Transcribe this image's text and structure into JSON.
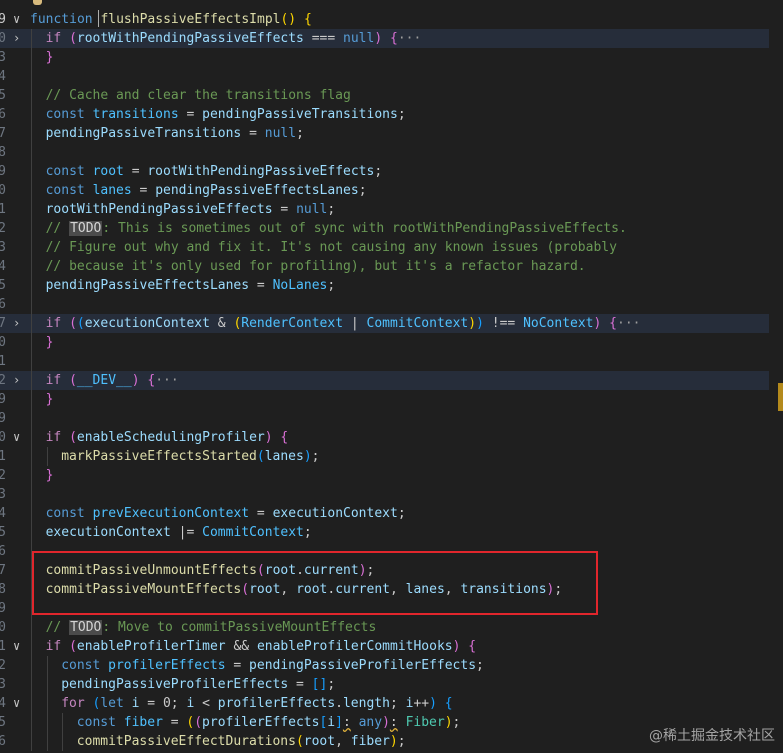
{
  "editor": {
    "lines": [
      {
        "n": "9",
        "fold": "∨",
        "fold_name": "chevron-down-icon",
        "cur": true,
        "hl": false,
        "indent": 0,
        "t": [
          [
            "kw",
            "function"
          ],
          [
            "p",
            " "
          ],
          [
            "fn",
            "flushPassiveEffectsImpl"
          ],
          [
            "b1",
            "("
          ],
          [
            "b1",
            ")"
          ],
          [
            "p",
            " "
          ],
          [
            "b1",
            "{"
          ]
        ]
      },
      {
        "n": "0",
        "fold": "›",
        "fold_name": "chevron-right-icon",
        "hl": true,
        "indent": 1,
        "t": [
          [
            "pc",
            "if"
          ],
          [
            "p",
            " "
          ],
          [
            "b2",
            "("
          ],
          [
            "vr",
            "rootWithPendingPassiveEffects"
          ],
          [
            "p",
            " === "
          ],
          [
            "kw",
            "null"
          ],
          [
            "b2",
            ")"
          ],
          [
            "p",
            " "
          ],
          [
            "b2",
            "{"
          ],
          [
            "ell",
            "···"
          ]
        ]
      },
      {
        "n": "3",
        "indent": 1,
        "t": [
          [
            "b2",
            "}"
          ]
        ]
      },
      {
        "n": "4",
        "indent": 1,
        "t": []
      },
      {
        "n": "5",
        "indent": 1,
        "t": [
          [
            "cm",
            "// Cache and clear the transitions flag"
          ]
        ]
      },
      {
        "n": "6",
        "indent": 1,
        "t": [
          [
            "kw",
            "const"
          ],
          [
            "p",
            " "
          ],
          [
            "cn",
            "transitions"
          ],
          [
            "p",
            " = "
          ],
          [
            "vr",
            "pendingPassiveTransitions"
          ],
          [
            "p",
            ";"
          ]
        ]
      },
      {
        "n": "7",
        "indent": 1,
        "t": [
          [
            "vr",
            "pendingPassiveTransitions"
          ],
          [
            "p",
            " = "
          ],
          [
            "kw",
            "null"
          ],
          [
            "p",
            ";"
          ]
        ]
      },
      {
        "n": "8",
        "indent": 1,
        "t": []
      },
      {
        "n": "9",
        "indent": 1,
        "t": [
          [
            "kw",
            "const"
          ],
          [
            "p",
            " "
          ],
          [
            "cn",
            "root"
          ],
          [
            "p",
            " = "
          ],
          [
            "vr",
            "rootWithPendingPassiveEffects"
          ],
          [
            "p",
            ";"
          ]
        ]
      },
      {
        "n": "0",
        "indent": 1,
        "t": [
          [
            "kw",
            "const"
          ],
          [
            "p",
            " "
          ],
          [
            "cn",
            "lanes"
          ],
          [
            "p",
            " = "
          ],
          [
            "vr",
            "pendingPassiveEffectsLanes"
          ],
          [
            "p",
            ";"
          ]
        ]
      },
      {
        "n": "1",
        "indent": 1,
        "t": [
          [
            "vr",
            "rootWithPendingPassiveEffects"
          ],
          [
            "p",
            " = "
          ],
          [
            "kw",
            "null"
          ],
          [
            "p",
            ";"
          ]
        ]
      },
      {
        "n": "2",
        "indent": 1,
        "t": [
          [
            "cm",
            "// "
          ],
          [
            "todo",
            "TODO"
          ],
          [
            "cm",
            ": This is sometimes out of sync with rootWithPendingPassiveEffects."
          ]
        ]
      },
      {
        "n": "3",
        "indent": 1,
        "t": [
          [
            "cm",
            "// Figure out why and fix it. It's not causing any known issues (probably"
          ]
        ]
      },
      {
        "n": "4",
        "indent": 1,
        "t": [
          [
            "cm",
            "// because it's only used for profiling), but it's a refactor hazard."
          ]
        ]
      },
      {
        "n": "5",
        "indent": 1,
        "t": [
          [
            "vr",
            "pendingPassiveEffectsLanes"
          ],
          [
            "p",
            " = "
          ],
          [
            "cn",
            "NoLanes"
          ],
          [
            "p",
            ";"
          ]
        ]
      },
      {
        "n": "6",
        "indent": 1,
        "t": []
      },
      {
        "n": "7",
        "fold": "›",
        "fold_name": "chevron-right-icon",
        "hl": true,
        "indent": 1,
        "t": [
          [
            "pc",
            "if"
          ],
          [
            "p",
            " "
          ],
          [
            "b2",
            "("
          ],
          [
            "b3",
            "("
          ],
          [
            "vr",
            "executionContext"
          ],
          [
            "p",
            " & "
          ],
          [
            "b1",
            "("
          ],
          [
            "cn",
            "RenderContext"
          ],
          [
            "p",
            " | "
          ],
          [
            "cn",
            "CommitContext"
          ],
          [
            "b1",
            ")"
          ],
          [
            "b3",
            ")"
          ],
          [
            "p",
            " !== "
          ],
          [
            "cn",
            "NoContext"
          ],
          [
            "b2",
            ")"
          ],
          [
            "p",
            " "
          ],
          [
            "b2",
            "{"
          ],
          [
            "ell",
            "···"
          ]
        ]
      },
      {
        "n": "0",
        "indent": 1,
        "t": [
          [
            "b2",
            "}"
          ]
        ]
      },
      {
        "n": "1",
        "indent": 1,
        "t": []
      },
      {
        "n": "2",
        "fold": "›",
        "fold_name": "chevron-right-icon",
        "hl": true,
        "indent": 1,
        "t": [
          [
            "pc",
            "if"
          ],
          [
            "p",
            " "
          ],
          [
            "b2",
            "("
          ],
          [
            "cn",
            "__DEV__"
          ],
          [
            "b2",
            ")"
          ],
          [
            "p",
            " "
          ],
          [
            "b2",
            "{"
          ],
          [
            "ell",
            "···"
          ]
        ]
      },
      {
        "n": "9",
        "indent": 1,
        "t": [
          [
            "b2",
            "}"
          ]
        ]
      },
      {
        "n": "9",
        "indent": 1,
        "t": []
      },
      {
        "n": "0",
        "fold": "∨",
        "fold_name": "chevron-down-icon",
        "indent": 1,
        "t": [
          [
            "pc",
            "if"
          ],
          [
            "p",
            " "
          ],
          [
            "b2",
            "("
          ],
          [
            "vr",
            "enableSchedulingProfiler"
          ],
          [
            "b2",
            ")"
          ],
          [
            "p",
            " "
          ],
          [
            "b2",
            "{"
          ]
        ]
      },
      {
        "n": "1",
        "indent": 2,
        "t": [
          [
            "fn",
            "markPassiveEffectsStarted"
          ],
          [
            "b3",
            "("
          ],
          [
            "vr",
            "lanes"
          ],
          [
            "b3",
            ")"
          ],
          [
            "p",
            ";"
          ]
        ]
      },
      {
        "n": "2",
        "indent": 1,
        "t": [
          [
            "b2",
            "}"
          ]
        ]
      },
      {
        "n": "3",
        "indent": 1,
        "t": []
      },
      {
        "n": "4",
        "indent": 1,
        "t": [
          [
            "kw",
            "const"
          ],
          [
            "p",
            " "
          ],
          [
            "cn",
            "prevExecutionContext"
          ],
          [
            "p",
            " = "
          ],
          [
            "vr",
            "executionContext"
          ],
          [
            "p",
            ";"
          ]
        ]
      },
      {
        "n": "5",
        "indent": 1,
        "t": [
          [
            "vr",
            "executionContext"
          ],
          [
            "p",
            " |= "
          ],
          [
            "cn",
            "CommitContext"
          ],
          [
            "p",
            ";"
          ]
        ]
      },
      {
        "n": "6",
        "indent": 1,
        "t": []
      },
      {
        "n": "7",
        "indent": 1,
        "t": [
          [
            "fn",
            "commitPassiveUnmountEffects"
          ],
          [
            "b2",
            "("
          ],
          [
            "vr",
            "root"
          ],
          [
            "p",
            "."
          ],
          [
            "vr",
            "current"
          ],
          [
            "b2",
            ")"
          ],
          [
            "p",
            ";"
          ]
        ]
      },
      {
        "n": "8",
        "indent": 1,
        "t": [
          [
            "fn",
            "commitPassiveMountEffects"
          ],
          [
            "b2",
            "("
          ],
          [
            "vr",
            "root"
          ],
          [
            "p",
            ", "
          ],
          [
            "vr",
            "root"
          ],
          [
            "p",
            "."
          ],
          [
            "vr",
            "current"
          ],
          [
            "p",
            ", "
          ],
          [
            "vr",
            "lanes"
          ],
          [
            "p",
            ", "
          ],
          [
            "vr",
            "transitions"
          ],
          [
            "b2",
            ")"
          ],
          [
            "p",
            ";"
          ]
        ]
      },
      {
        "n": "9",
        "indent": 1,
        "t": []
      },
      {
        "n": "0",
        "indent": 1,
        "t": [
          [
            "cm",
            "// "
          ],
          [
            "todo",
            "TODO"
          ],
          [
            "cm",
            ": Move to commitPassiveMountEffects"
          ]
        ]
      },
      {
        "n": "1",
        "fold": "∨",
        "fold_name": "chevron-down-icon",
        "indent": 1,
        "t": [
          [
            "pc",
            "if"
          ],
          [
            "p",
            " "
          ],
          [
            "b2",
            "("
          ],
          [
            "vr",
            "enableProfilerTimer"
          ],
          [
            "p",
            " && "
          ],
          [
            "vr",
            "enableProfilerCommitHooks"
          ],
          [
            "b2",
            ")"
          ],
          [
            "p",
            " "
          ],
          [
            "b2",
            "{"
          ]
        ]
      },
      {
        "n": "2",
        "indent": 2,
        "t": [
          [
            "kw",
            "const"
          ],
          [
            "p",
            " "
          ],
          [
            "cn",
            "profilerEffects"
          ],
          [
            "p",
            " = "
          ],
          [
            "vr",
            "pendingPassiveProfilerEffects"
          ],
          [
            "p",
            ";"
          ]
        ]
      },
      {
        "n": "3",
        "indent": 2,
        "t": [
          [
            "vr",
            "pendingPassiveProfilerEffects"
          ],
          [
            "p",
            " = "
          ],
          [
            "b3",
            "["
          ],
          [
            "b3",
            "]"
          ],
          [
            "p",
            ";"
          ]
        ]
      },
      {
        "n": "4",
        "fold": "∨",
        "fold_name": "chevron-down-icon",
        "indent": 2,
        "t": [
          [
            "pc",
            "for"
          ],
          [
            "p",
            " "
          ],
          [
            "b3",
            "("
          ],
          [
            "kw",
            "let"
          ],
          [
            "p",
            " "
          ],
          [
            "vr",
            "i"
          ],
          [
            "p",
            " = 0; "
          ],
          [
            "vr",
            "i"
          ],
          [
            "p",
            " < "
          ],
          [
            "vr",
            "profilerEffects"
          ],
          [
            "p",
            "."
          ],
          [
            "vr",
            "length"
          ],
          [
            "p",
            "; "
          ],
          [
            "vr",
            "i"
          ],
          [
            "p",
            "++"
          ],
          [
            "b3",
            ")"
          ],
          [
            "p",
            " "
          ],
          [
            "b3",
            "{"
          ]
        ]
      },
      {
        "n": "5",
        "indent": 3,
        "t": [
          [
            "kw",
            "const"
          ],
          [
            "p",
            " "
          ],
          [
            "cn",
            "fiber"
          ],
          [
            "p",
            " = "
          ],
          [
            "b1",
            "("
          ],
          [
            "b2",
            "("
          ],
          [
            "vr",
            "profilerEffects"
          ],
          [
            "b3",
            "["
          ],
          [
            "vr",
            "i"
          ],
          [
            "b3",
            "]"
          ],
          [
            "sq",
            ":"
          ],
          [
            "p",
            " "
          ],
          [
            "kw",
            "any"
          ],
          [
            "b2",
            ")"
          ],
          [
            "sq",
            ":"
          ],
          [
            "p",
            " "
          ],
          [
            "ty",
            "Fiber"
          ],
          [
            "b1",
            ")"
          ],
          [
            "p",
            ";"
          ]
        ]
      },
      {
        "n": "6",
        "indent": 3,
        "t": [
          [
            "fn",
            "commitPassiveEffectDurations"
          ],
          [
            "b1",
            "("
          ],
          [
            "vr",
            "root"
          ],
          [
            "p",
            ", "
          ],
          [
            "vr",
            "fiber"
          ],
          [
            "b1",
            ")"
          ],
          [
            "p",
            ";"
          ]
        ]
      }
    ]
  },
  "watermark": "@稀土掘金技术社区"
}
